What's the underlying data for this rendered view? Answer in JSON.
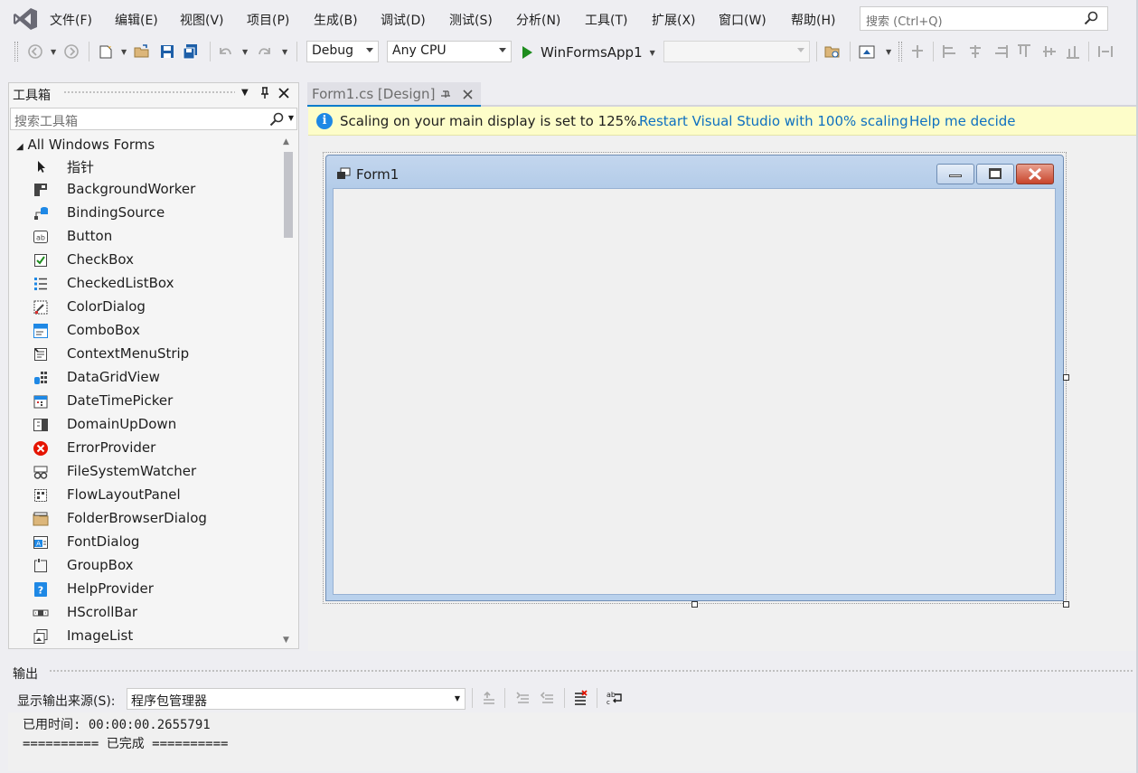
{
  "menu": {
    "items": [
      "文件(F)",
      "编辑(E)",
      "视图(V)",
      "项目(P)",
      "生成(B)",
      "调试(D)",
      "测试(S)",
      "分析(N)",
      "工具(T)",
      "扩展(X)",
      "窗口(W)",
      "帮助(H)"
    ],
    "search_placeholder": "搜索 (Ctrl+Q)"
  },
  "toolbar": {
    "config": "Debug",
    "platform": "Any CPU",
    "run_label": "WinFormsApp1",
    "run_color": "#1e8c1e"
  },
  "toolbox": {
    "title": "工具箱",
    "search_placeholder": "搜索工具箱",
    "group": "All Windows Forms",
    "items": [
      {
        "label": "指针",
        "icon": "pointer-icon"
      },
      {
        "label": "BackgroundWorker",
        "icon": "backgroundworker-icon"
      },
      {
        "label": "BindingSource",
        "icon": "bindingsource-icon"
      },
      {
        "label": "Button",
        "icon": "button-icon"
      },
      {
        "label": "CheckBox",
        "icon": "checkbox-icon"
      },
      {
        "label": "CheckedListBox",
        "icon": "checkedlistbox-icon"
      },
      {
        "label": "ColorDialog",
        "icon": "colordialog-icon"
      },
      {
        "label": "ComboBox",
        "icon": "combobox-icon"
      },
      {
        "label": "ContextMenuStrip",
        "icon": "contextmenustrip-icon"
      },
      {
        "label": "DataGridView",
        "icon": "datagridview-icon"
      },
      {
        "label": "DateTimePicker",
        "icon": "datetimepicker-icon"
      },
      {
        "label": "DomainUpDown",
        "icon": "domainupdown-icon"
      },
      {
        "label": "ErrorProvider",
        "icon": "errorprovider-icon"
      },
      {
        "label": "FileSystemWatcher",
        "icon": "filesystemwatcher-icon"
      },
      {
        "label": "FlowLayoutPanel",
        "icon": "flowlayoutpanel-icon"
      },
      {
        "label": "FolderBrowserDialog",
        "icon": "folderbrowserdialog-icon"
      },
      {
        "label": "FontDialog",
        "icon": "fontdialog-icon"
      },
      {
        "label": "GroupBox",
        "icon": "groupbox-icon"
      },
      {
        "label": "HelpProvider",
        "icon": "helpprovider-icon"
      },
      {
        "label": "HScrollBar",
        "icon": "hscrollbar-icon"
      },
      {
        "label": "ImageList",
        "icon": "imagelist-icon"
      }
    ]
  },
  "document": {
    "tab_title": "Form1.cs [Design]",
    "info_message": "Scaling on your main display is set to 125%.",
    "info_link_restart": "Restart Visual Studio with 100% scaling",
    "info_link_help": "Help me decide",
    "form_title": "Form1"
  },
  "output": {
    "title": "输出",
    "source_label": "显示输出来源(S):",
    "source_value": "程序包管理器",
    "lines": [
      "已用时间: 00:00:00.2655791",
      "========== 已完成 =========="
    ]
  },
  "colors": {
    "accent": "#007acc",
    "link": "#0e70c0",
    "infobar": "#fdfdc9"
  }
}
